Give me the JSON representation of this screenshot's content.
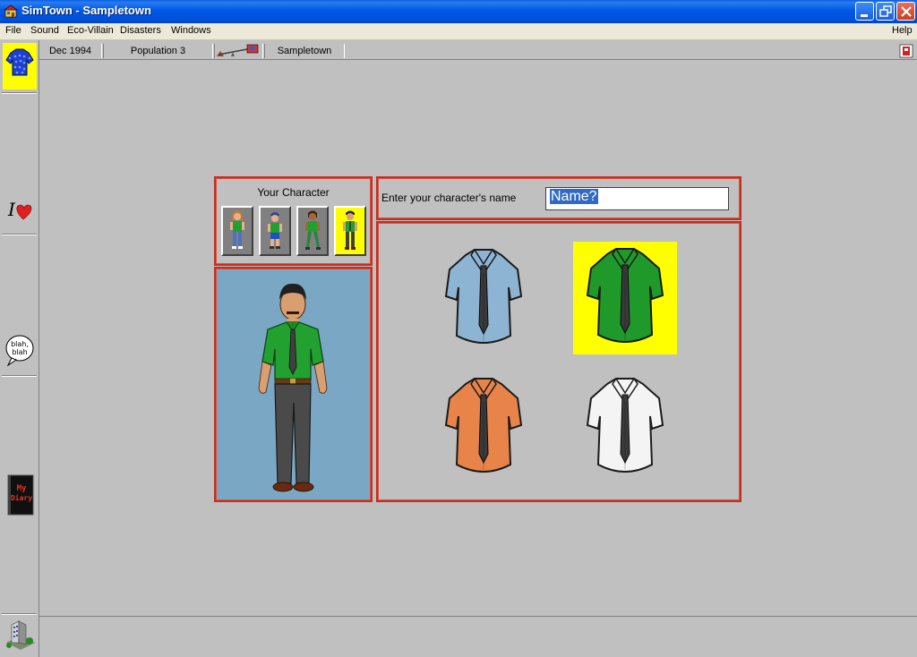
{
  "window": {
    "title": "SimTown - Sampletown"
  },
  "menu": {
    "items": [
      "File",
      "Sound",
      "Eco-Villain",
      "Disasters",
      "Windows"
    ],
    "help": "Help"
  },
  "status": {
    "date": "Dec 1994",
    "population": "Population 3",
    "town": "Sampletown"
  },
  "palette": {
    "tools": [
      {
        "name": "shirt-tool",
        "selected": true
      },
      {
        "name": "i-love-tool",
        "letter": "I",
        "selected": false
      },
      {
        "name": "blah-blah-tool",
        "text": [
          "blah,",
          "blah"
        ],
        "selected": false
      },
      {
        "name": "my-diary-tool",
        "text": [
          "My",
          "Diary"
        ],
        "selected": false
      }
    ]
  },
  "character": {
    "title": "Your Character",
    "options": [
      {
        "name": "girl-character",
        "selected": false
      },
      {
        "name": "boy-character",
        "selected": false
      },
      {
        "name": "woman-character",
        "selected": false
      },
      {
        "name": "man-character",
        "selected": true
      }
    ]
  },
  "name_field": {
    "label": "Enter your character's name",
    "value": "Name?"
  },
  "shirts": [
    {
      "name": "blue-shirt",
      "color": "#8eb4d4",
      "selected": false
    },
    {
      "name": "green-shirt",
      "color": "#1f9a2a",
      "selected": true
    },
    {
      "name": "orange-shirt",
      "color": "#e8844a",
      "selected": false
    },
    {
      "name": "white-shirt",
      "color": "#f4f4f4",
      "selected": false
    }
  ],
  "colors": {
    "selection": "#ffff00",
    "panel_border": "#c03020",
    "portrait_bg": "#7aa8c4"
  }
}
